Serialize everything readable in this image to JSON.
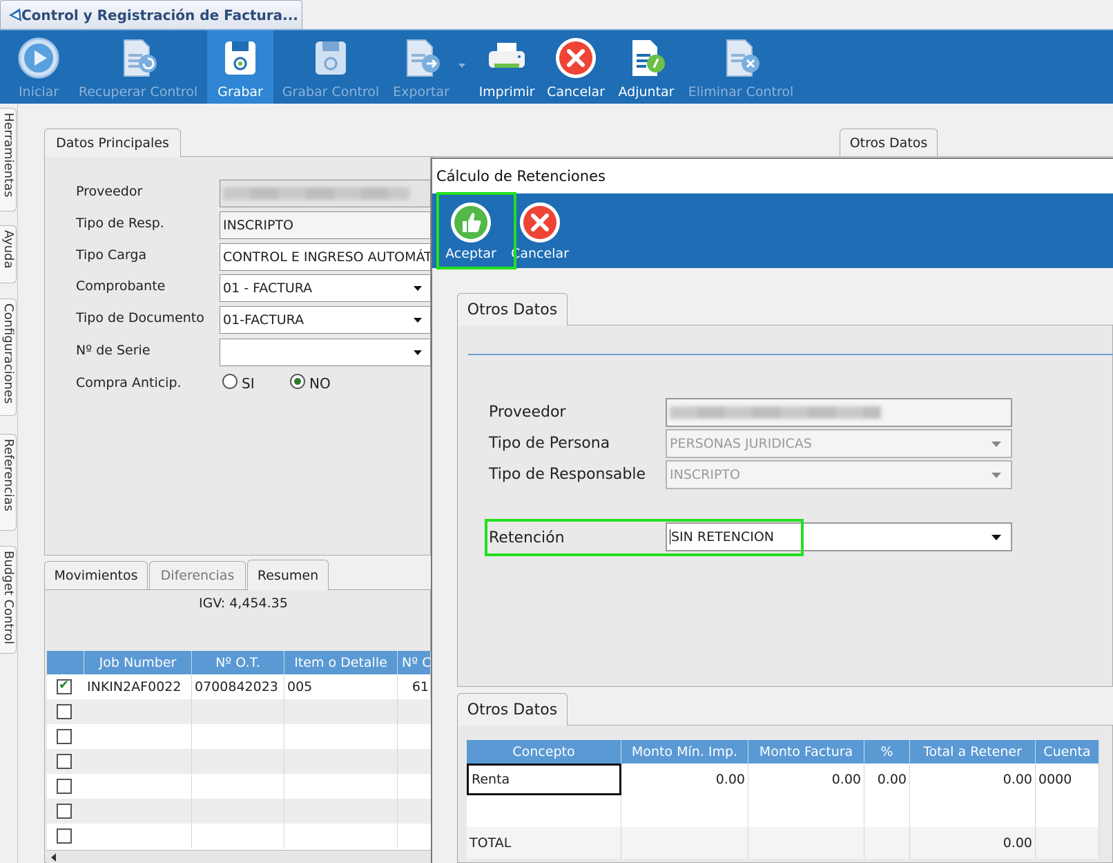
{
  "window": {
    "title": "Control y Registración de Factura..."
  },
  "toolbar": {
    "items": [
      {
        "label": "Iniciar",
        "icon": "play-icon",
        "enabled": false
      },
      {
        "label": "Recuperar Control",
        "icon": "document-restore-icon",
        "enabled": false
      },
      {
        "label": "Grabar",
        "icon": "save-disk-icon",
        "enabled": true
      },
      {
        "label": "Grabar Control",
        "icon": "save-disk-icon",
        "enabled": false
      },
      {
        "label": "Exportar",
        "icon": "document-export-icon",
        "enabled": false
      },
      {
        "label": "Imprimir",
        "icon": "printer-icon",
        "enabled": true
      },
      {
        "label": "Cancelar",
        "icon": "cancel-x-icon",
        "enabled": true
      },
      {
        "label": "Adjuntar",
        "icon": "attach-clip-icon",
        "enabled": true
      },
      {
        "label": "Eliminar Control",
        "icon": "document-delete-icon",
        "enabled": false
      }
    ]
  },
  "side_tabs": [
    "Herramientas",
    "Ayuda",
    "Configuraciones",
    "Referencias",
    "Budget Control"
  ],
  "main": {
    "tabs": {
      "left": "Datos Principales",
      "right": "Otros Datos"
    },
    "fields": [
      {
        "label": "Proveedor",
        "value": ""
      },
      {
        "label": "Tipo de Resp.",
        "value": "INSCRIPTO"
      },
      {
        "label": "Tipo Carga",
        "value": "CONTROL E INGRESO AUTOMÁTIC"
      },
      {
        "label": "Comprobante",
        "value": "01 - FACTURA"
      },
      {
        "label": "Tipo de Documento",
        "value": "01-FACTURA"
      },
      {
        "label": "Nº de Serie",
        "value": ""
      }
    ],
    "compra_anticip": {
      "label": "Compra Anticip.",
      "options": [
        "SI",
        "NO"
      ],
      "selected": "NO"
    }
  },
  "lower": {
    "tabs": [
      "Movimientos",
      "Diferencias",
      "Resumen"
    ],
    "igv_text": "IGV: 4,454.35",
    "columns": [
      "Job Number",
      "Nº O.T.",
      "Item o Detalle",
      "Nº C"
    ],
    "rows": [
      {
        "checked": true,
        "job": "INKIN2AF0022",
        "ot": "0700842023",
        "item": "005",
        "nc": "61"
      },
      {
        "checked": false,
        "job": "",
        "ot": "",
        "item": "",
        "nc": ""
      },
      {
        "checked": false,
        "job": "",
        "ot": "",
        "item": "",
        "nc": ""
      },
      {
        "checked": false,
        "job": "",
        "ot": "",
        "item": "",
        "nc": ""
      },
      {
        "checked": false,
        "job": "",
        "ot": "",
        "item": "",
        "nc": ""
      },
      {
        "checked": false,
        "job": "",
        "ot": "",
        "item": "",
        "nc": ""
      },
      {
        "checked": false,
        "job": "",
        "ot": "",
        "item": "",
        "nc": ""
      }
    ]
  },
  "dialog": {
    "title": "Cálculo de Retenciones",
    "buttons": [
      {
        "label": "Aceptar",
        "icon": "thumbs-up-icon"
      },
      {
        "label": "Cancelar",
        "icon": "cancel-x-icon"
      }
    ],
    "section1_tab": "Otros Datos",
    "fields": [
      {
        "label": "Proveedor",
        "value": ""
      },
      {
        "label": "Tipo de Persona",
        "value": "PERSONAS JURIDICAS"
      },
      {
        "label": "Tipo de Responsable",
        "value": "INSCRIPTO"
      }
    ],
    "retencion": {
      "label": "Retención",
      "value": "SIN RETENCION"
    },
    "section2_tab": "Otros Datos",
    "table": {
      "columns": [
        "Concepto",
        "Monto Mín. Imp.",
        "Monto Factura",
        "%",
        "Total a Retener",
        "Cuenta"
      ],
      "rows": [
        {
          "concepto": "Renta",
          "monto_min": "0.00",
          "monto_factura": "0.00",
          "pct": "0.00",
          "total": "0.00",
          "cuenta": "0000"
        }
      ],
      "total_label": "TOTAL",
      "total_value": "0.00"
    }
  },
  "colors": {
    "toolbar_blue": "#1e6db5",
    "grid_header_blue": "#5a99d4",
    "highlight_green": "#22e01f"
  }
}
